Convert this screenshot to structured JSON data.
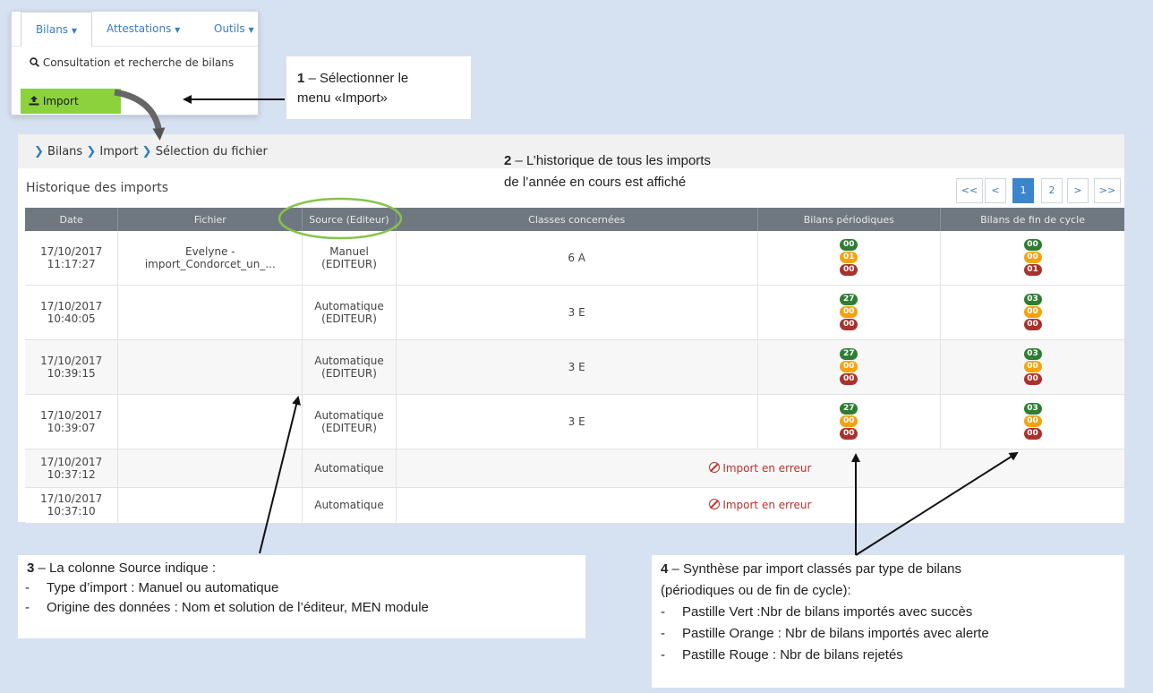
{
  "menu": {
    "tabs": [
      {
        "label": "Bilans"
      },
      {
        "label": "Attestations"
      },
      {
        "label": "Outils"
      }
    ],
    "search_item": "Consultation et recherche de bilans",
    "import_item": "Import"
  },
  "callouts": {
    "c1_num": "1",
    "c1_line1": " – Sélectionner le",
    "c1_line2": "menu «Import»",
    "c2_num": "2",
    "c2_line1": " – L’historique de tous les imports",
    "c2_line2": "de l’année en cours est affiché",
    "c3_num": "3",
    "c3_line1": " – La colonne Source indique :",
    "c3_bullets": [
      "Type d’import : Manuel  ou automatique",
      "Origine des données : Nom et solution de l’éditeur,  MEN module"
    ],
    "c4_num": "4",
    "c4_line1": " – Synthèse par import classés par type de bilans",
    "c4_line2": "(périodiques  ou de fin de cycle):",
    "c4_bullets": [
      "Pastille Vert :Nbr de bilans importés avec succès",
      "Pastille Orange : Nbr de bilans importés avec alerte",
      "Pastille Rouge : Nbr de bilans rejetés"
    ]
  },
  "breadcrumb": [
    "Bilans",
    "Import",
    "Sélection du fichier"
  ],
  "history_title": "Historique des imports",
  "pagination": [
    "<<",
    "<",
    "1",
    "2",
    ">",
    ">>"
  ],
  "table": {
    "headers": [
      "Date",
      "Fichier",
      "Source (Editeur)",
      "Classes concernées",
      "Bilans périodiques",
      "Bilans de fin de cycle"
    ],
    "rows": [
      {
        "date1": "17/10/2017",
        "date2": "11:17:27",
        "file1": "Evelyne -",
        "file2": "import_Condorcet_un_...",
        "src1": "Manuel",
        "src2": "(EDITEUR)",
        "classe": "6 A",
        "per": [
          "00",
          "01",
          "00"
        ],
        "fin": [
          "00",
          "00",
          "01"
        ]
      },
      {
        "date1": "17/10/2017",
        "date2": "10:40:05",
        "file1": "",
        "file2": "",
        "src1": "Automatique",
        "src2": "(EDITEUR)",
        "classe": "3 E",
        "per": [
          "27",
          "00",
          "00"
        ],
        "fin": [
          "03",
          "00",
          "00"
        ]
      },
      {
        "date1": "17/10/2017",
        "date2": "10:39:15",
        "file1": "",
        "file2": "",
        "src1": "Automatique",
        "src2": "(EDITEUR)",
        "classe": "3 E",
        "per": [
          "27",
          "00",
          "00"
        ],
        "fin": [
          "03",
          "00",
          "00"
        ]
      },
      {
        "date1": "17/10/2017",
        "date2": "10:39:07",
        "file1": "",
        "file2": "",
        "src1": "Automatique",
        "src2": "(EDITEUR)",
        "classe": "3 E",
        "per": [
          "27",
          "00",
          "00"
        ],
        "fin": [
          "03",
          "00",
          "00"
        ]
      },
      {
        "date1": "17/10/2017",
        "date2": "10:37:12",
        "src1": "Automatique",
        "error": "Import en erreur"
      },
      {
        "date1": "17/10/2017",
        "date2": "10:37:10",
        "src1": "Automatique",
        "error": "Import en erreur"
      }
    ]
  },
  "colors": {
    "green": "#2e7d32",
    "orange": "#f3a30f",
    "red": "#a8322d",
    "highlight": "#8bd23c",
    "accent": "#3b85cf"
  }
}
